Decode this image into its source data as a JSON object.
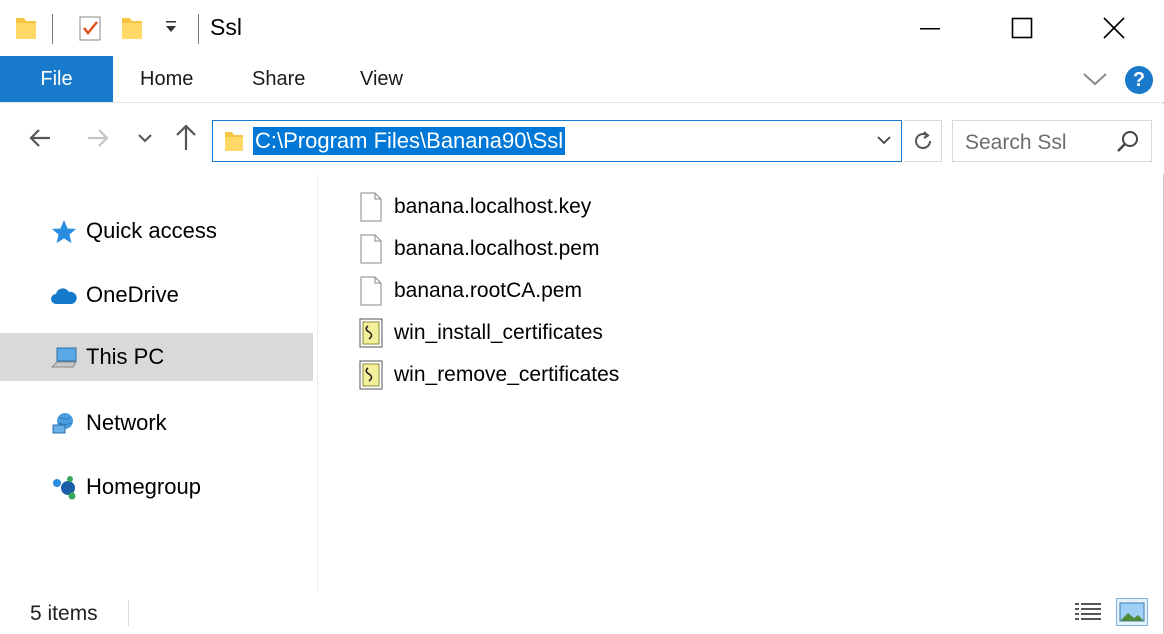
{
  "window": {
    "title": "Ssl",
    "controls": {
      "minimize": "minimize",
      "maximize": "maximize",
      "close": "close"
    }
  },
  "quick_access_toolbar": [
    "folder-icon",
    "properties-icon",
    "new-folder-icon",
    "customize-dropdown-icon"
  ],
  "ribbon": {
    "tabs": [
      {
        "label": "File",
        "active": true
      },
      {
        "label": "Home"
      },
      {
        "label": "Share"
      },
      {
        "label": "View"
      }
    ],
    "help_label": "?",
    "accent": "#1979ca"
  },
  "address_bar": {
    "path": "C:\\Program Files\\Banana90\\Ssl",
    "selection_color": "#0078d7"
  },
  "search": {
    "placeholder": "Search Ssl"
  },
  "sidebar": {
    "items": [
      {
        "label": "Quick access",
        "icon": "star-icon"
      },
      {
        "label": "OneDrive",
        "icon": "cloud-icon"
      },
      {
        "label": "This PC",
        "icon": "computer-icon",
        "selected": true
      },
      {
        "label": "Network",
        "icon": "network-icon"
      },
      {
        "label": "Homegroup",
        "icon": "homegroup-icon"
      }
    ]
  },
  "files": [
    {
      "name": "banana.localhost.key",
      "icon": "file-icon"
    },
    {
      "name": "banana.localhost.pem",
      "icon": "file-icon"
    },
    {
      "name": "banana.rootCA.pem",
      "icon": "file-icon"
    },
    {
      "name": "win_install_certificates",
      "icon": "script-icon"
    },
    {
      "name": "win_remove_certificates",
      "icon": "script-icon"
    }
  ],
  "status": {
    "item_count": "5 items"
  }
}
